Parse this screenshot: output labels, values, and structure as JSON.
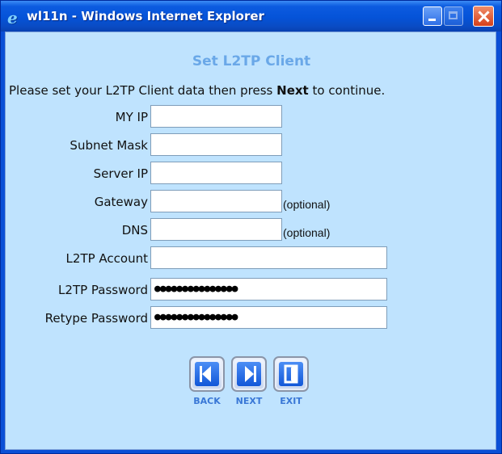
{
  "window": {
    "title": "wl11n - Windows Internet Explorer",
    "icons": [
      "ie-icon",
      "minimize-icon",
      "maximize-icon",
      "close-icon"
    ]
  },
  "page": {
    "heading": "Set L2TP Client",
    "instruction_before": "Please set your L2TP Client data then press ",
    "instruction_bold": "Next",
    "instruction_after": " to continue."
  },
  "form": {
    "my_ip": {
      "label": "MY IP",
      "value": ""
    },
    "subnet_mask": {
      "label": "Subnet Mask",
      "value": ""
    },
    "server_ip": {
      "label": "Server IP",
      "value": ""
    },
    "gateway": {
      "label": "Gateway",
      "value": "",
      "note": "(optional)"
    },
    "dns": {
      "label": "DNS",
      "value": "",
      "note": "(optional)"
    },
    "account": {
      "label": "L2TP Account",
      "value": ""
    },
    "password": {
      "label": "L2TP Password",
      "value": "●●●●●●●●●●●●●●●"
    },
    "retype": {
      "label": "Retype Password",
      "value": "●●●●●●●●●●●●●●●"
    }
  },
  "nav": {
    "back": "BACK",
    "next": "NEXT",
    "exit": "EXIT"
  },
  "colors": {
    "title_bar": "#0553d8",
    "page_background": "#bfe3fe",
    "heading": "#6aa8e8",
    "button_face": "#1257d8"
  }
}
